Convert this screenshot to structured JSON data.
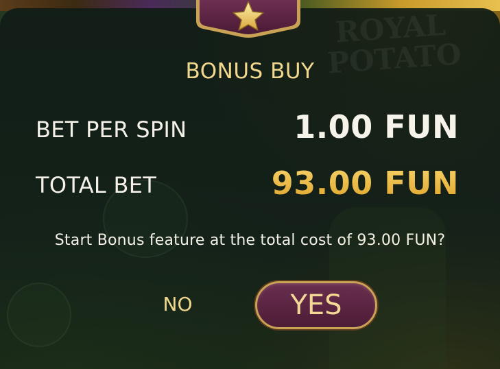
{
  "dialog": {
    "title": "BONUS BUY",
    "bet_per_spin_label": "BET PER SPIN",
    "bet_per_spin_value": "1.00 FUN",
    "total_bet_label": "TOTAL BET",
    "total_bet_value": "93.00 FUN",
    "question": "Start Bonus feature at the total cost of 93.00 FUN?",
    "no_label": "NO",
    "yes_label": "YES"
  },
  "badge": {
    "icon": "star-icon"
  },
  "background": {
    "logo_text_line1": "ROYAL",
    "logo_text_line2": "POTATO"
  },
  "colors": {
    "title_gold": "#f2d88e",
    "total_value_gold": "#e8b43c",
    "yes_button_fill": "#5a2442",
    "yes_button_border": "#c9a256",
    "panel": "#13221a"
  }
}
